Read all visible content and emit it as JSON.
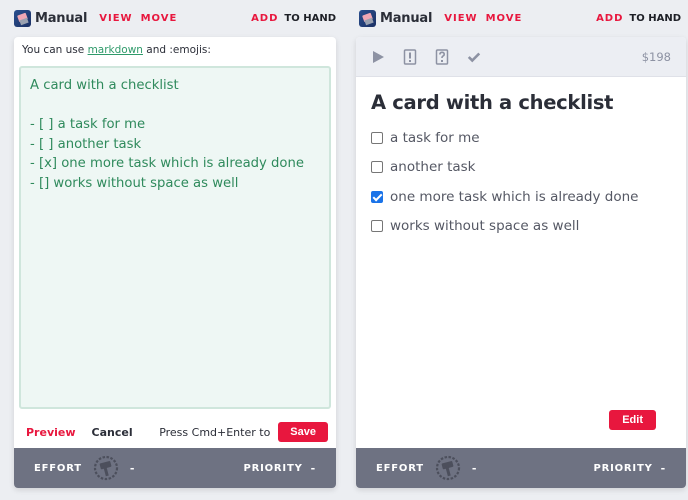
{
  "panels": [
    {
      "header": {
        "deck_name": "Manual",
        "nav": [
          "VIEW",
          "MOVE"
        ],
        "add_label": "ADD",
        "hand_label": "TO HAND"
      },
      "editor": {
        "hint_prefix": "You can use ",
        "hint_link": "markdown",
        "hint_suffix": " and :emojis:",
        "content": "A card with a checklist\n\n- [ ] a task for me\n- [ ] another task\n- [x] one more task which is already done\n- [] works without space as well",
        "preview_label": "Preview",
        "cancel_label": "Cancel",
        "press_hint": "Press Cmd+Enter to",
        "save_label": "Save"
      },
      "footer": {
        "effort_label": "EFFORT",
        "effort_value": "-",
        "priority_label": "PRIORITY",
        "priority_value": "-"
      }
    },
    {
      "header": {
        "deck_name": "Manual",
        "nav": [
          "VIEW",
          "MOVE"
        ],
        "add_label": "ADD",
        "hand_label": "TO HAND"
      },
      "toolbar": {
        "icons": [
          "play-icon",
          "exclamation-card-icon",
          "question-card-icon",
          "checkmark-icon"
        ],
        "price": "$198"
      },
      "card": {
        "title": "A card with a checklist",
        "checklist": [
          {
            "label": "a task for me",
            "checked": false
          },
          {
            "label": "another task",
            "checked": false
          },
          {
            "label": "one more task which is already done",
            "checked": true
          },
          {
            "label": "works without space as well",
            "checked": false
          }
        ],
        "edit_label": "Edit"
      },
      "footer": {
        "effort_label": "EFFORT",
        "effort_value": "-",
        "priority_label": "PRIORITY",
        "priority_value": "-"
      }
    }
  ],
  "colors": {
    "accent": "#e8173e",
    "editor_text": "#2f8a5c",
    "footer_bg": "#6e7282"
  }
}
